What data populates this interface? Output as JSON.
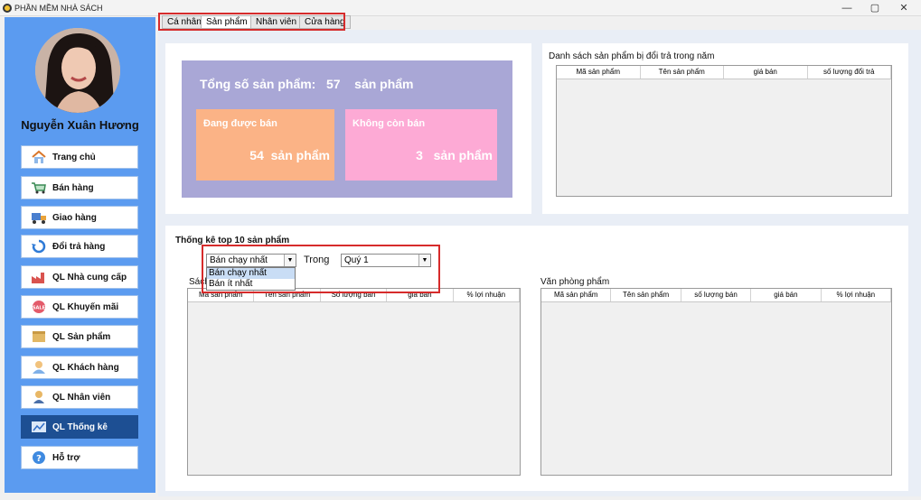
{
  "window": {
    "title": "PHẦN MỀM NHÀ SÁCH",
    "min_icon": "minimize-icon",
    "restore_icon": "restore-icon",
    "close_icon": "close-icon"
  },
  "user": {
    "name": "Nguyễn Xuân Hương"
  },
  "sidebar": {
    "items": [
      {
        "label": "Trang chủ",
        "icon": "home-icon"
      },
      {
        "label": "Bán hàng",
        "icon": "cart-icon"
      },
      {
        "label": "Giao hàng",
        "icon": "truck-icon"
      },
      {
        "label": "Đổi trả hàng",
        "icon": "return-icon"
      },
      {
        "label": "QL Nhà cung cấp",
        "icon": "factory-icon"
      },
      {
        "label": "QL Khuyến mãi",
        "icon": "sale-icon"
      },
      {
        "label": "QL Sản phẩm",
        "icon": "box-icon"
      },
      {
        "label": "QL Khách hàng",
        "icon": "customer-icon"
      },
      {
        "label": "QL Nhân viên",
        "icon": "employee-icon"
      },
      {
        "label": "QL Thống kê",
        "icon": "chart-icon",
        "active": true
      },
      {
        "label": "Hỗ trợ",
        "icon": "help-icon"
      }
    ]
  },
  "tabs": [
    "Cá nhân",
    "Sản phẩm",
    "Nhân viên",
    "Cửa hàng"
  ],
  "summary": {
    "total_label": "Tổng số sản phẩm:",
    "total_value": "57",
    "total_unit": "sản phẩm",
    "selling_label": "Đang được bán",
    "selling_value": "54",
    "selling_unit": "sản phẩm",
    "discontinued_label": "Không còn bán",
    "discontinued_value": "3",
    "discontinued_unit": "sản phẩm"
  },
  "returns": {
    "title": "Danh sách sản phẩm bị đổi trả trong năm",
    "columns": [
      "Mã sản phẩm",
      "Tên sản phẩm",
      "giá bán",
      "số lượng đổi trả"
    ]
  },
  "top10": {
    "title": "Thống kê top 10 sản phẩm",
    "filter_value": "Bán chạy nhất",
    "filter_options": [
      "Bán chạy nhất",
      "Bán ít nhất"
    ],
    "within_label": "Trong",
    "period_value": "Quý 1",
    "books": {
      "title": "Sách",
      "columns": [
        "Mã sản phẩm",
        "Tên sản phẩm",
        "Số lượng bán",
        "giá bán",
        "% lợi nhuận"
      ]
    },
    "stationery": {
      "title": "Văn phòng phẩm",
      "columns": [
        "Mã sản phẩm",
        "Tên sản phẩm",
        "số lượng bán",
        "giá bán",
        "% lợi nhuận"
      ]
    }
  }
}
